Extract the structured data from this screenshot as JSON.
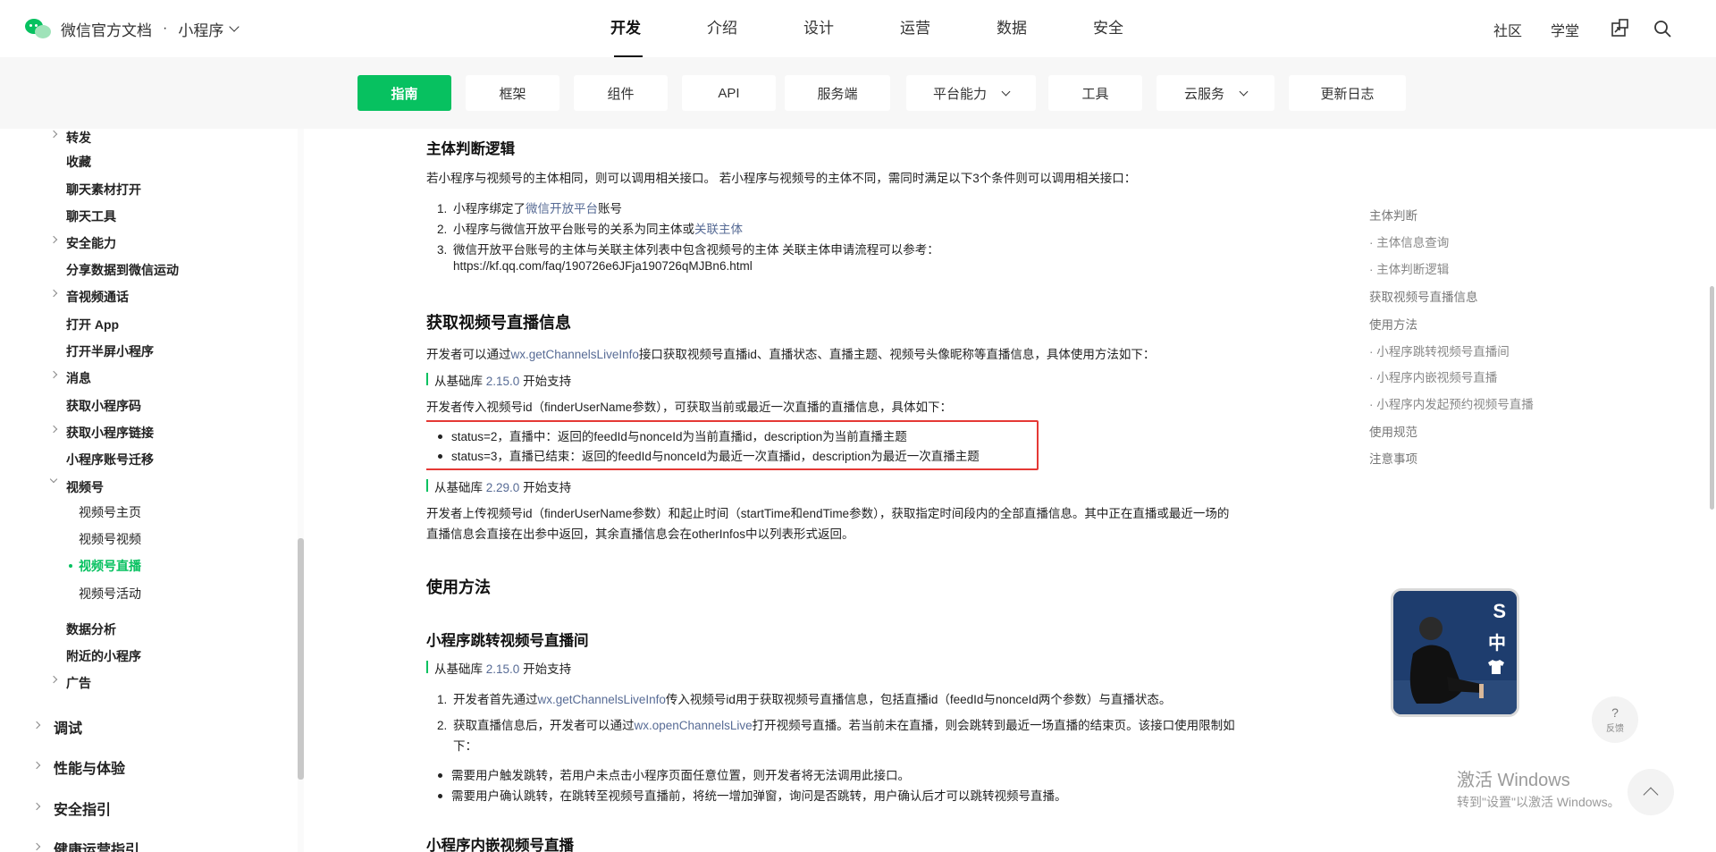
{
  "brand": {
    "title": "微信官方文档",
    "separator": "·",
    "product": "小程序"
  },
  "main_nav": [
    "开发",
    "介绍",
    "设计",
    "运营",
    "数据",
    "安全"
  ],
  "right_nav": {
    "community": "社区",
    "academy": "学堂"
  },
  "sub_nav": [
    "指南",
    "框架",
    "组件",
    "API",
    "服务端",
    "平台能力",
    "工具",
    "云服务",
    "更新日志"
  ],
  "sidebar": {
    "items": [
      "转发",
      "收藏",
      "聊天素材打开",
      "聊天工具",
      "安全能力",
      "分享数据到微信运动",
      "音视频通话",
      "打开 App",
      "打开半屏小程序",
      "消息",
      "获取小程序码",
      "获取小程序链接",
      "小程序账号迁移",
      "视频号",
      "视频号主页",
      "视频号视频",
      "视频号直播",
      "视频号活动",
      "数据分析",
      "附近的小程序",
      "广告"
    ],
    "sections": [
      "调试",
      "性能与体验",
      "安全指引",
      "健康运营指引"
    ]
  },
  "content": {
    "h_subject_logic": "主体判断逻辑",
    "p_subject": "若小程序与视频号的主体相同，则可以调用相关接口。 若小程序与视频号的主体不同，需同时满足以下3个条件则可以调用相关接口：",
    "ol1": {
      "n1": "1.",
      "i1_pre": "小程序绑定了",
      "i1_link": "微信开放平台",
      "i1_post": "账号",
      "n2": "2.",
      "i2_pre": "小程序与微信开放平台账号的关系为同主体或",
      "i2_link": "关联主体",
      "n3": "3.",
      "i3": "微信开放平台账号的主体与关联主体列表中包含视频号的主体 关联主体申请流程可以参考：",
      "i3_url": "https://kf.qq.com/faq/190726e6JFja190726qMJBn6.html"
    },
    "h_live_info": "获取视频号直播信息",
    "p_live_pre": "开发者可以通过",
    "p_live_link": "wx.getChannelsLiveInfo",
    "p_live_post": "接口获取视频号直播id、直播状态、直播主题、视频号头像昵称等直播信息，具体使用方法如下：",
    "since_pre": "从基础库 ",
    "since_post": " 开始支持",
    "v1": "2.15.0",
    "p_input": "开发者传入视频号id（finderUserName参数），可获取当前或最近一次直播的直播信息，具体如下：",
    "bullet1": "status=2，直播中：返回的feedId与nonceId为当前直播id，description为当前直播主题",
    "bullet2": "status=3，直播已结束：返回的feedId与nonceId为最近一次直播id，description为最近一次直播主题",
    "v2": "2.29.0",
    "p_range1": "开发者上传视频号id（finderUserName参数）和起止时间（startTime和endTime参数），获取指定时间段内的全部直播信息。其中正在直播或最近一场的",
    "p_range2": "直播信息会直接在出参中返回，其余直播信息会在otherInfos中以列表形式返回。",
    "h_usage": "使用方法",
    "h_jump": "小程序跳转视频号直播间",
    "v3": "2.15.0",
    "step1_num": "1.",
    "step1_pre": "开发者首先通过",
    "step1_link": "wx.getChannelsLiveInfo",
    "step1_post": "传入视频号id用于获取视频号直播信息，包括直播id（feedId与nonceId两个参数）与直播状态。",
    "step2_num": "2.",
    "step2_pre": "获取直播信息后，开发者可以通过",
    "step2_link": "wx.openChannelsLive",
    "step2_post": "打开视频号直播。若当前未在直播，则会跳转到最近一场直播的结束页。该接口使用限制如",
    "step2_cont": "下：",
    "limit1": "需要用户触发跳转，若用户未点击小程序页面任意位置，则开发者将无法调用此接口。",
    "limit2": "需要用户确认跳转，在跳转至视频号直播前，将统一增加弹窗，询问是否跳转，用户确认后才可以跳转视频号直播。",
    "h_embed": "小程序内嵌视频号直播"
  },
  "toc": [
    "主体判断",
    "· 主体信息查询",
    "· 主体判断逻辑",
    "获取视频号直播信息",
    "使用方法",
    "· 小程序跳转视频号直播间",
    "· 小程序内嵌视频号直播",
    "· 小程序内发起预约视频号直播",
    "使用规范",
    "注意事项"
  ],
  "avatar": {
    "line1": "S",
    "line2": "中"
  },
  "feedback": {
    "mark": "?",
    "label": "反馈"
  },
  "watermark": {
    "line1": "激活 Windows",
    "line2": "转到\"设置\"以激活 Windows。"
  },
  "colors": {
    "accent": "#07c160",
    "link": "#576b95",
    "highlight_box": "#e53935"
  }
}
